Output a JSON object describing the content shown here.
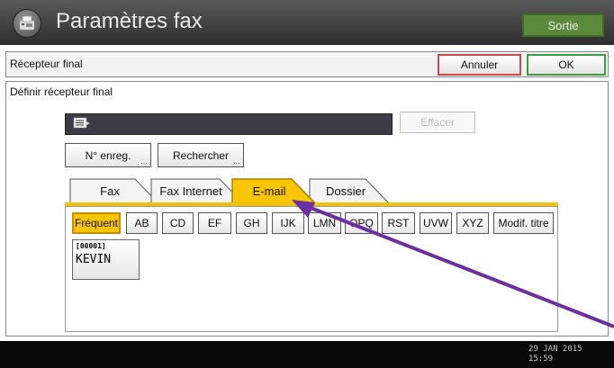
{
  "header": {
    "title": "Paramètres fax",
    "exit_label": "Sortie"
  },
  "dialog": {
    "title": "Récepteur final",
    "cancel_label": "Annuler",
    "ok_label": "OK"
  },
  "panel": {
    "title": "Définir récepteur final",
    "destination_value": "",
    "clear_label": "Effacer",
    "reg_number_label": "N° enreg.",
    "search_label": "Rechercher"
  },
  "tabs": [
    {
      "label": "Fax",
      "selected": false
    },
    {
      "label": "Fax Internet",
      "selected": false
    },
    {
      "label": "E-mail",
      "selected": true
    },
    {
      "label": "Dossier",
      "selected": false
    }
  ],
  "alpha_buttons": [
    "Fréquent",
    "AB",
    "CD",
    "EF",
    "GH",
    "IJK",
    "LMN",
    "OPQ",
    "RST",
    "UVW",
    "XYZ",
    "Modif. titre"
  ],
  "active_alpha": "Fréquent",
  "entries": [
    {
      "number": "[00001]",
      "name": "KEVIN"
    }
  ],
  "status": {
    "date": "29 JAN  2015",
    "time": "15:59"
  },
  "colors": {
    "accent": "#f2c20a",
    "cancel_border": "#c84a4a",
    "ok_border": "#3d9a3d",
    "exit_button": "#5a8a3a",
    "arrow": "#6b2fa0"
  },
  "icons": {
    "app": "fax-icon",
    "destination": "email-icon"
  }
}
